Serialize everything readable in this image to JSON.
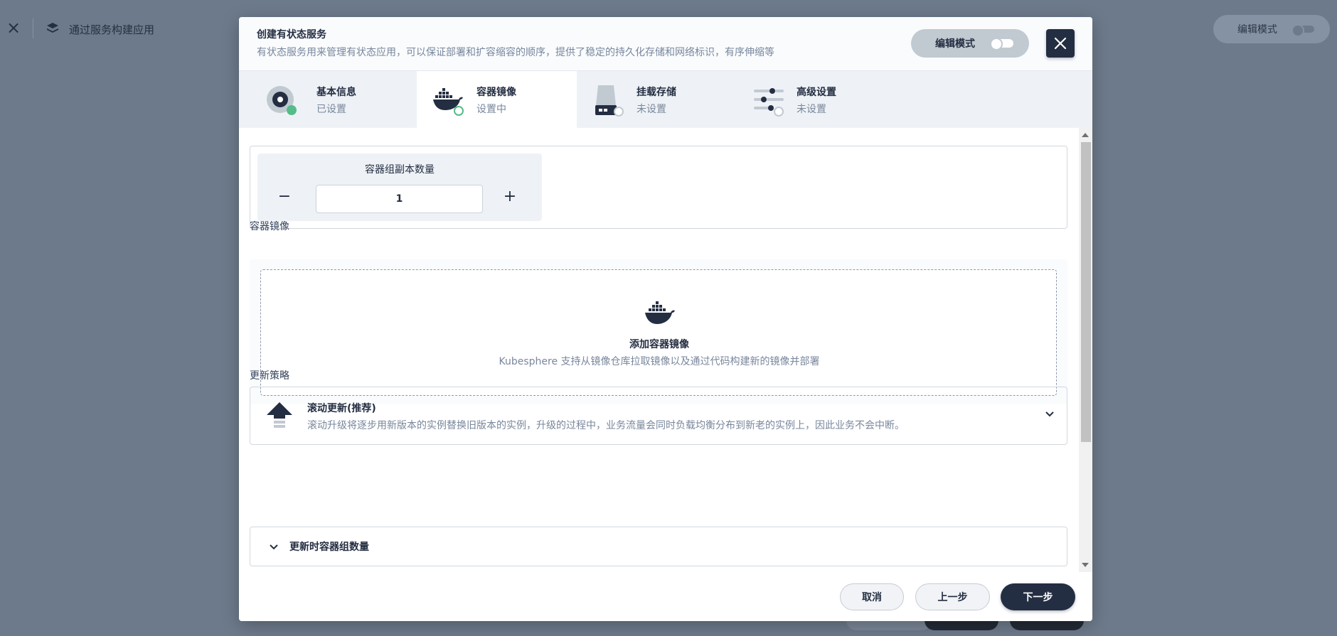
{
  "background": {
    "title": "通过服务构建应用",
    "edit_mode": "编辑模式"
  },
  "modal": {
    "title": "创建有状态服务",
    "description": "有状态服务用来管理有状态应用，可以保证部署和扩容缩容的顺序，提供了稳定的持久化存储和网络标识，有序伸缩等",
    "edit_mode": "编辑模式",
    "steps": [
      {
        "label": "基本信息",
        "status": "已设置",
        "icon": "basic-info-icon"
      },
      {
        "label": "容器镜像",
        "status": "设置中",
        "icon": "docker-icon"
      },
      {
        "label": "挂载存储",
        "status": "未设置",
        "icon": "storage-icon"
      },
      {
        "label": "高级设置",
        "status": "未设置",
        "icon": "settings-sliders-icon"
      }
    ],
    "replicas": {
      "label": "容器组副本数量",
      "value": "1",
      "minus": "−",
      "plus": "+"
    },
    "image_section": {
      "title": "容器镜像",
      "add_title": "添加容器镜像",
      "add_desc": "Kubesphere 支持从镜像仓库拉取镜像以及通过代码构建新的镜像并部署"
    },
    "update_section": {
      "title": "更新策略",
      "strategy_name": "滚动更新(推荐)",
      "strategy_desc": "滚动升级将逐步用新版本的实例替换旧版本的实例，升级的过程中，业务流量会同时负载均衡分布到新老的实例上，因此业务不会中断。",
      "pods_title": "更新时容器组数量"
    },
    "footer": {
      "cancel": "取消",
      "prev": "上一步",
      "next": "下一步"
    }
  },
  "colors": {
    "primary_dark": "#242e42",
    "success": "#55bc8a",
    "muted_text": "#79879c",
    "overlay": "#6d7a8b"
  }
}
